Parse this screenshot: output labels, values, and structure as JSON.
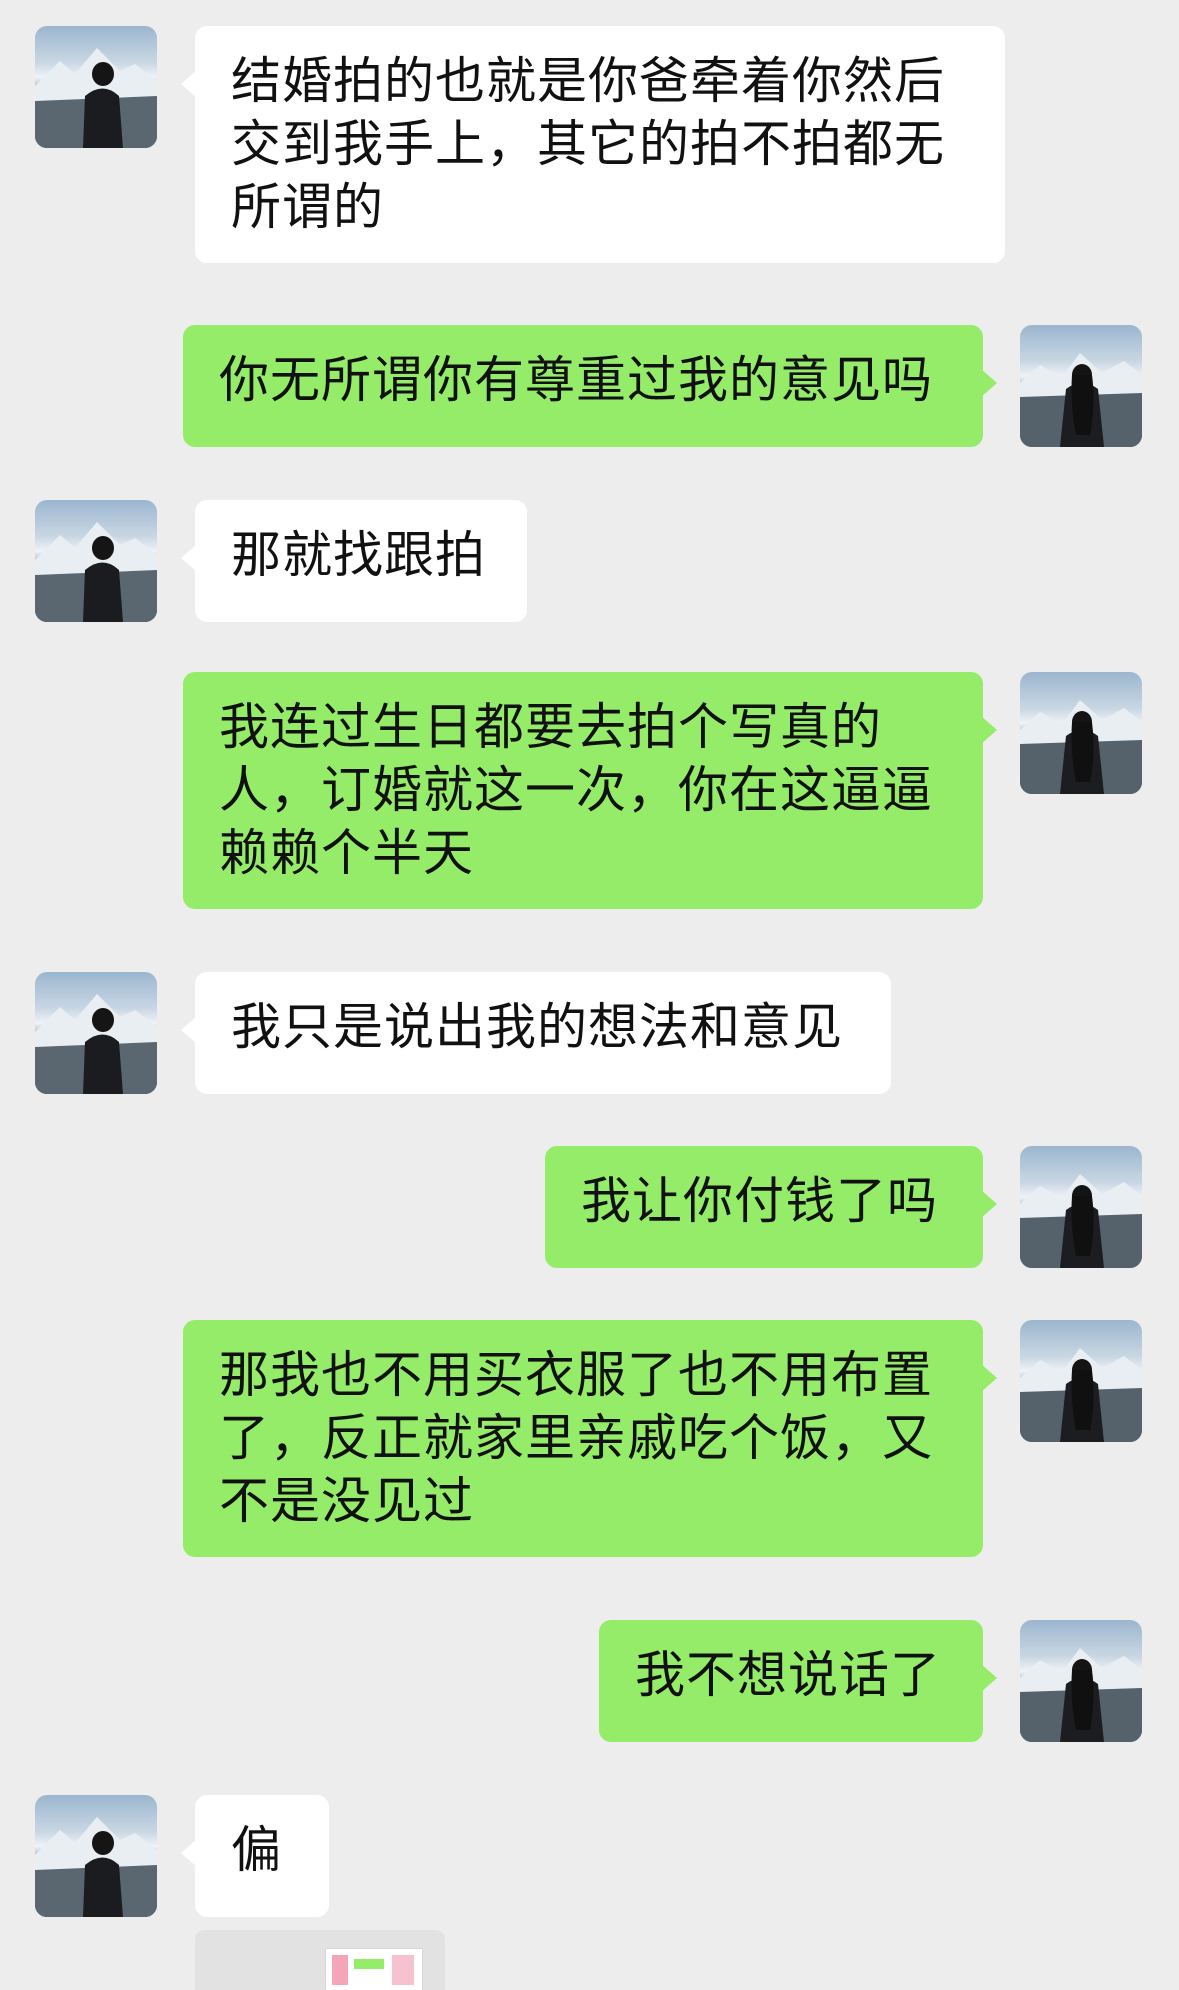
{
  "messages": [
    {
      "side": "left",
      "lines": [
        "结婚拍的也就是你爸牵着你然后",
        "交到我手上，其它的拍不拍都无",
        "所谓的"
      ]
    },
    {
      "side": "right",
      "lines": [
        "你无所谓你有尊重过我的意见吗"
      ]
    },
    {
      "side": "left",
      "lines": [
        "那就找跟拍"
      ]
    },
    {
      "side": "right",
      "lines": [
        "我连过生日都要去拍个写真的",
        "人，订婚就这一次，你在这逼逼",
        "赖赖个半天"
      ]
    },
    {
      "side": "left",
      "lines": [
        "我只是说出我的想法和意见"
      ]
    },
    {
      "side": "right",
      "lines": [
        "我让你付钱了吗"
      ]
    },
    {
      "side": "right",
      "lines": [
        "那我也不用买衣服了也不用布置",
        "了，反正就家里亲戚吃个饭，又",
        "不是没见过"
      ]
    },
    {
      "side": "right",
      "lines": [
        "我不想说话了"
      ]
    },
    {
      "side": "left",
      "lines": [
        "偏"
      ]
    }
  ],
  "partial_message": {
    "text": ""
  },
  "colors": {
    "background": "#ededed",
    "left_bubble": "#ffffff",
    "right_bubble": "#95ec69",
    "text": "#111111"
  },
  "icons": {
    "left_avatar": "man-mountain-avatar",
    "right_avatar": "woman-mountain-avatar"
  }
}
